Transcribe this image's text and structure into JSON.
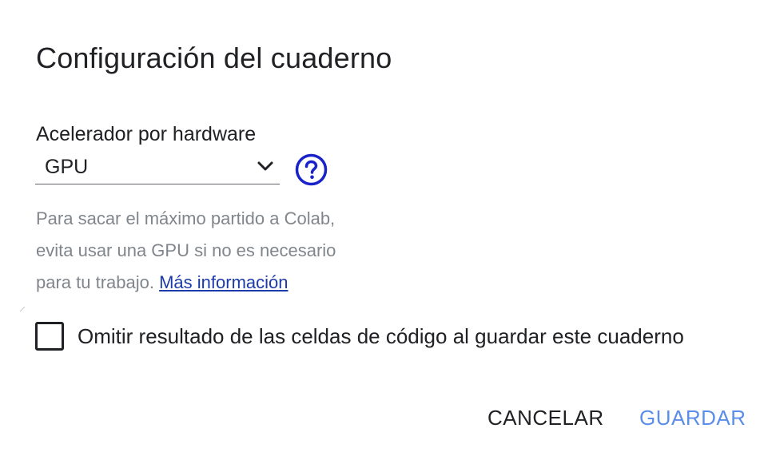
{
  "dialog": {
    "title": "Configuración del cuaderno",
    "accelerator": {
      "label": "Acelerador por hardware",
      "selected": "GPU",
      "help_icon": "help-circle-icon"
    },
    "help_text": {
      "line1": "Para sacar el máximo partido a Colab,",
      "line2": "evita usar una GPU si no es necesario",
      "line3_prefix": "para tu trabajo.",
      "link": "Más información"
    },
    "omit_output": {
      "label": "Omitir resultado de las celdas de código al guardar este cuaderno",
      "checked": false
    },
    "buttons": {
      "cancel": "CANCELAR",
      "save": "GUARDAR"
    },
    "colors": {
      "text": "#202124",
      "muted": "#80868b",
      "link": "#1c3aa9",
      "help_icon": "#1a23c9",
      "save_button": "#5b8ee8"
    }
  }
}
